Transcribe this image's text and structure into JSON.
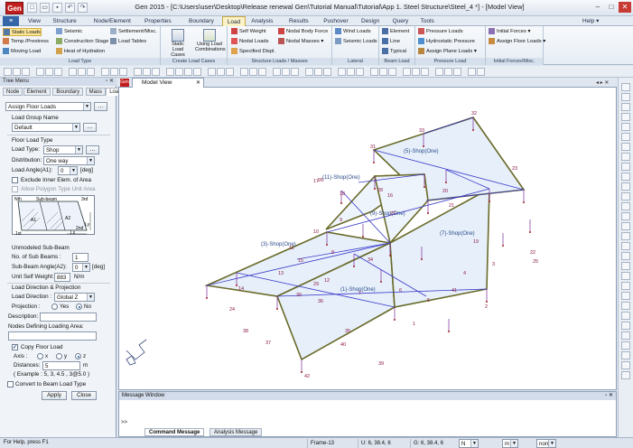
{
  "app": {
    "icon_text": "Gen",
    "title": "Gen 2015 - [C:\\Users\\user\\Desktop\\Release renewal Gen\\Tutorial Manual\\Tutorial\\App 1. Steel Structure\\Steel_4 *] - [Model View]"
  },
  "menu": {
    "file_label": "",
    "tabs": [
      "View",
      "Structure",
      "Node/Element",
      "Properties",
      "Boundary",
      "Load",
      "Analysis",
      "Results",
      "Pushover",
      "Design",
      "Query",
      "Tools"
    ],
    "active_tab": "Load",
    "help": "Help"
  },
  "ribbon": {
    "load_type": {
      "title": "Load Type",
      "items": [
        "Static Loads",
        "Seismic",
        "Settlement/Misc.",
        "Temp./Prestress",
        "Construction Stage",
        "Load Tables",
        "Moving Load",
        "Heat of Hydration"
      ]
    },
    "create_load_cases": {
      "title": "Create Load Cases",
      "items": [
        "Static Load Cases",
        "Using Load Combinations"
      ]
    },
    "structure_loads": {
      "title": "Structure Loads / Masses",
      "items": [
        "Self Weight",
        "Nodal Body Force",
        "Nodal Loads",
        "Nodal Masses",
        "Specified Displ."
      ]
    },
    "lateral": {
      "title": "Lateral",
      "items": [
        "Wind Loads",
        "Seismic Loads"
      ]
    },
    "beam_load": {
      "title": "Beam Load",
      "items": [
        "Element",
        "Line",
        "Typical"
      ]
    },
    "pressure_load": {
      "title": "Pressure Load",
      "items": [
        "Pressure Loads",
        "Hydrostatic Pressure",
        "Assign Plane Loads"
      ]
    },
    "initial_forces": {
      "title": "Initial Forces/Misc.",
      "items": [
        "Initial Forces",
        "Assign Floor Loads"
      ]
    }
  },
  "tree": {
    "title": "Tree Menu",
    "tabs": [
      "Node",
      "Element",
      "Boundary",
      "Mass",
      "Load"
    ],
    "active_tab": "Load",
    "command": "Assign Floor Loads",
    "load_group_name_label": "Load Group Name",
    "load_group_name_value": "Default",
    "floor_load_type_label": "Floor Load Type",
    "load_type_label": "Load Type:",
    "load_type_value": "Shop",
    "distribution_label": "Distribution:",
    "distribution_value": "One way",
    "load_angle_label": "Load Angle(A1):",
    "load_angle_value": "0",
    "load_angle_unit": "[deg]",
    "exclude_inner_label": "Exclude Inner Elem. of Area",
    "allow_polygon_label": "Allow Polygon Type Unit Area",
    "diagram": {
      "nth": "Nth",
      "sub_beam": "Sub-beam",
      "third": "3rd",
      "a1": "A1",
      "a2": "A2",
      "first": "1st",
      "second": "2nd",
      "lx": "Lx",
      "ly": "Ly"
    },
    "unmodeled_label": "Unmodeled Sub-Beam",
    "no_sub_beams_label": "No. of Sub Beams :",
    "no_sub_beams_value": "1",
    "sub_beam_angle_label": "Sub-Beam Angle(A2):",
    "sub_beam_angle_value": "0",
    "sub_beam_angle_unit": "[deg]",
    "unit_self_weight_label": "Unit Self Weight:",
    "unit_self_weight_value": "883",
    "unit_self_weight_unit": "N/m",
    "load_direction_projection_label": "Load Direction & Projection",
    "load_direction_label": "Load Direction :",
    "load_direction_value": "Global Z",
    "projection_label": "Projection :",
    "projection_yes": "Yes",
    "projection_no": "No",
    "description_label": "Description:",
    "nodes_defining_label": "Nodes Defining Loading Area:",
    "copy_floor_load_label": "Copy Floor Load",
    "axis_label": "Axis :",
    "axis_x": "x",
    "axis_y": "y",
    "axis_z": "z",
    "distances_label": "Distances:",
    "distances_value": "5",
    "distances_unit": "m",
    "example_text": "( Example :  5, 3, 4.5 , 3@5.0 )",
    "convert_label": "Convert to Beam Load Type",
    "apply_label": "Apply",
    "close_label": "Close"
  },
  "model_view": {
    "tab_label": "Model View",
    "region_labels": [
      "(1)-Shop(One)",
      "(3)-Shop(One)",
      "(5)-Shop(One)",
      "(7)-Shop(One)",
      "(11)-Shop(One)",
      "(9)-Shop(One)"
    ],
    "node_labels": [
      "32",
      "33",
      "31",
      "27",
      "28",
      "26",
      "25",
      "24",
      "17",
      "18",
      "16",
      "15",
      "41",
      "42",
      "39",
      "40",
      "37",
      "38",
      "36",
      "35",
      "23",
      "22",
      "21",
      "20",
      "19",
      "14",
      "13",
      "12",
      "11",
      "10",
      "9",
      "8",
      "7",
      "6",
      "5",
      "4",
      "3",
      "2",
      "1",
      "34",
      "29",
      "30"
    ]
  },
  "message_window": {
    "title": "Message Window",
    "prompt": ">>",
    "tabs": [
      "Command Message",
      "Analysis Message"
    ]
  },
  "status": {
    "help_text": "For Help, press F1",
    "frame": "Frame-13",
    "coord1": "U: 6, 38.4, 6",
    "coord2": "G: 6, 38.4, 6",
    "unit_force": "N",
    "unit_length": "m",
    "option": "non"
  }
}
